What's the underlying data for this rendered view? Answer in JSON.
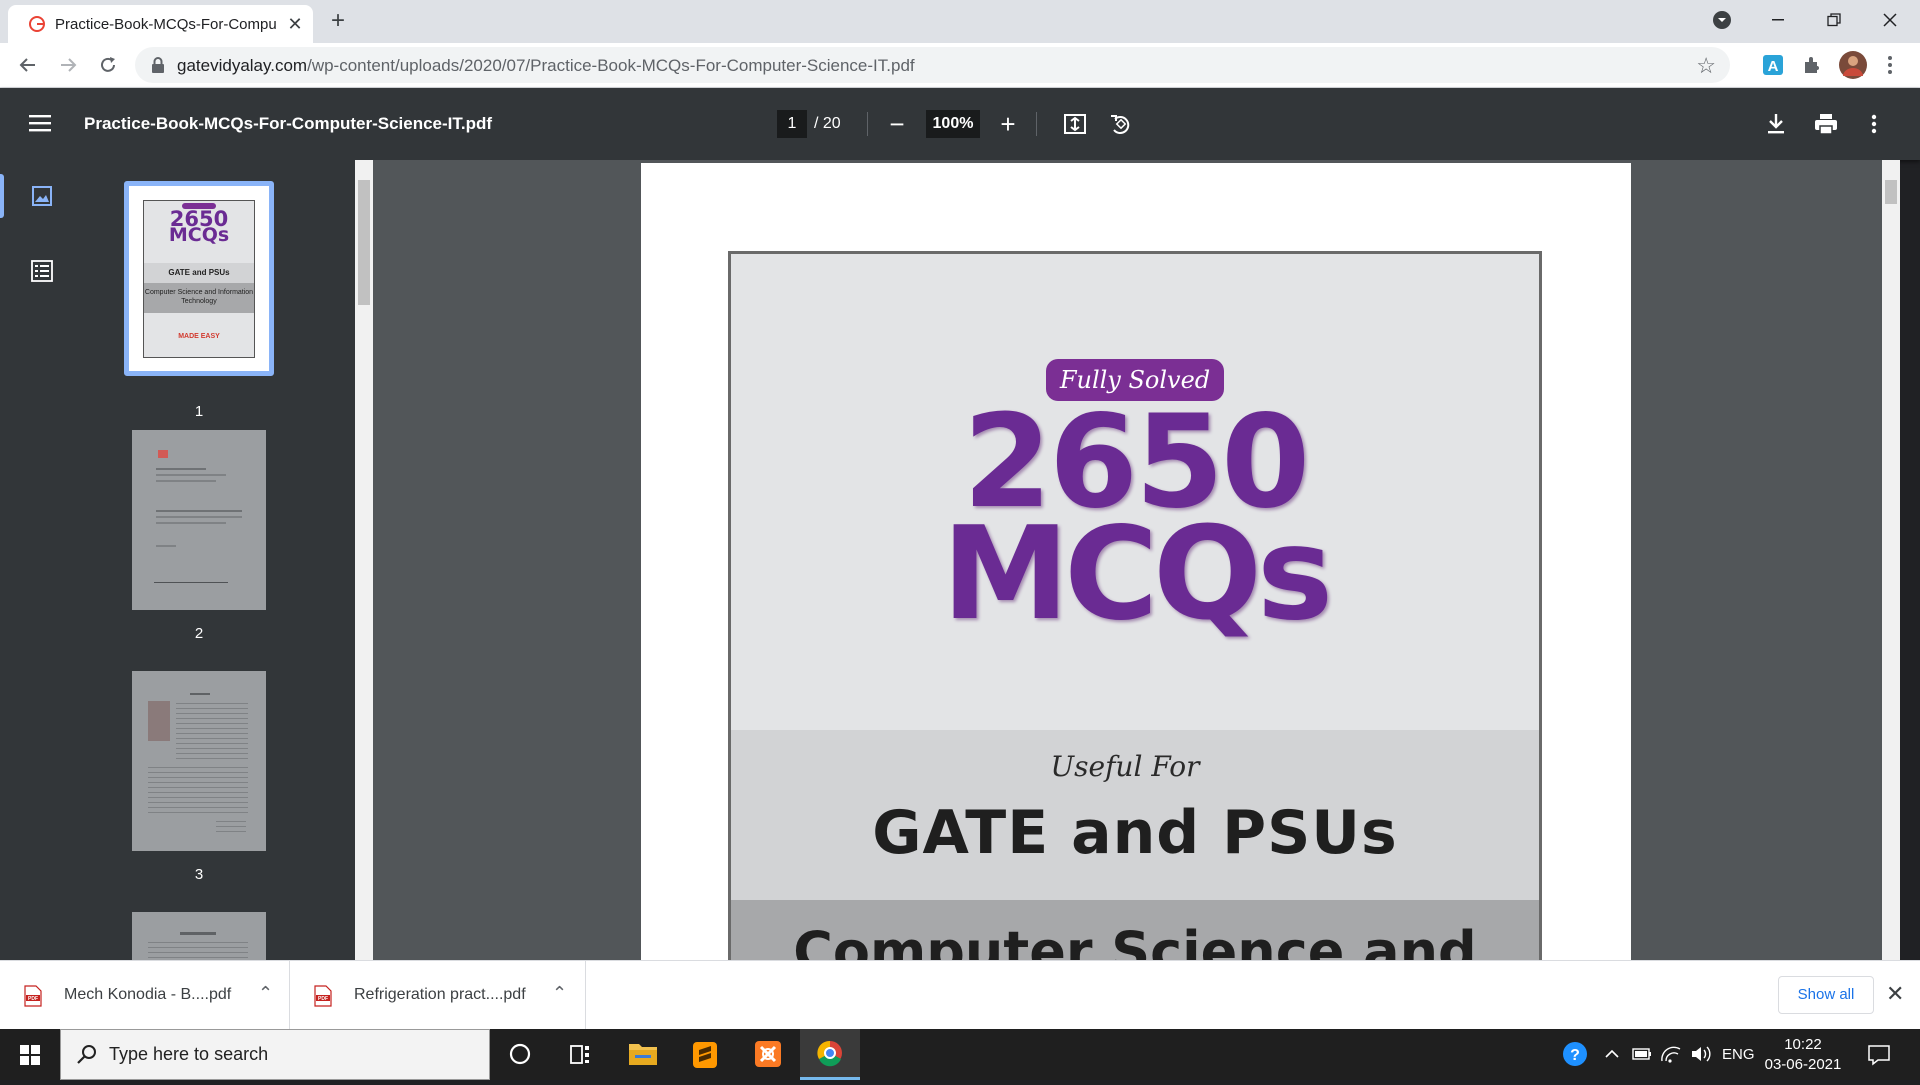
{
  "browser": {
    "tab_title": "Practice-Book-MCQs-For-Compu",
    "tab_close": "✕",
    "new_tab": "+",
    "url_domain": "gatevidyalay.com",
    "url_path": "/wp-content/uploads/2020/07/Practice-Book-MCQs-For-Computer-Science-IT.pdf"
  },
  "pdf_toolbar": {
    "title": "Practice-Book-MCQs-For-Computer-Science-IT.pdf",
    "current_page": "1",
    "total_pages": "/ 20",
    "zoom": "100%",
    "zoom_out": "−",
    "zoom_in": "+"
  },
  "thumbnails": [
    {
      "number": "1",
      "selected": true
    },
    {
      "number": "2",
      "selected": false
    },
    {
      "number": "3",
      "selected": false
    }
  ],
  "thumb1_text": {
    "big": "2650",
    "mcqs": "MCQs",
    "gate": "GATE and PSUs",
    "cs": "Computer Science and Information Technology",
    "brand": "MADE EASY"
  },
  "page_content": {
    "badge": "Fully Solved",
    "big_number": "2650",
    "big_word": "MCQs",
    "useful_for": "Useful For",
    "exam": "GATE and PSUs",
    "subject": "Computer Science and"
  },
  "downloads": [
    {
      "name": "Mech Konodia - B....pdf"
    },
    {
      "name": "Refrigeration pract....pdf"
    }
  ],
  "downloads_bar": {
    "show_all": "Show all",
    "close": "✕"
  },
  "taskbar": {
    "search_placeholder": "Type here to search",
    "language": "ENG",
    "time": "10:22",
    "date": "03-06-2021"
  },
  "colors": {
    "accent": "#8ab4f8",
    "cover_purple": "#6a2b93",
    "pdf_toolbar": "#323639"
  }
}
